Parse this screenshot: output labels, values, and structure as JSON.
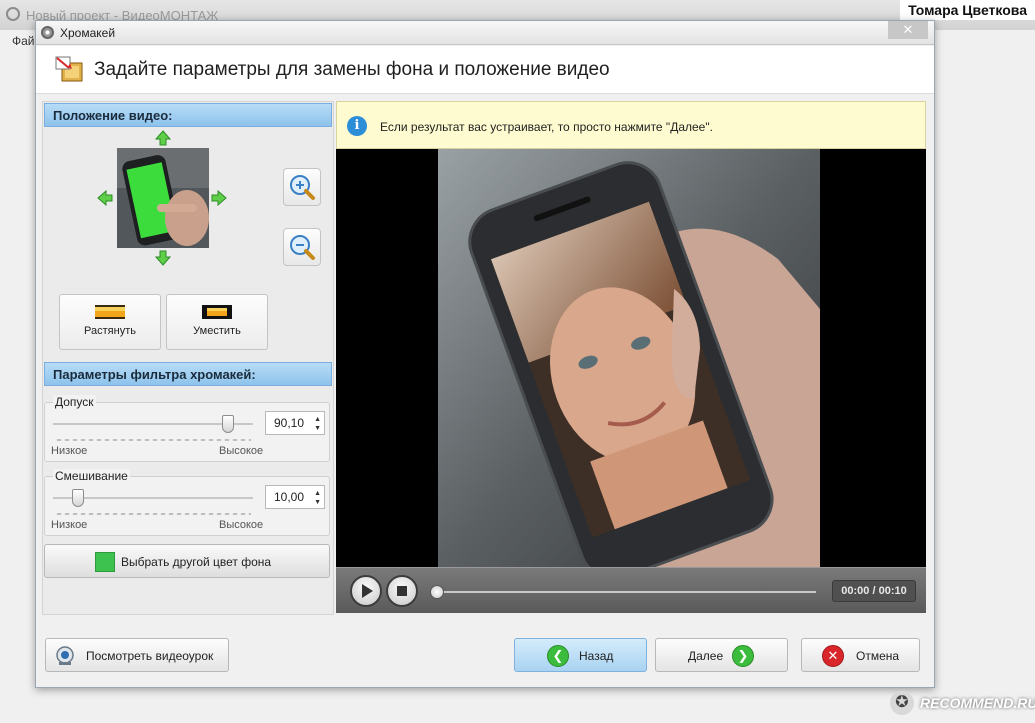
{
  "app": {
    "title": "Новый проект - ВидеоМОНТАЖ",
    "menu_file": "Фай",
    "user_overlay": "Томара Цветкова"
  },
  "dialog": {
    "title": "Хромакей",
    "close_label": "✕",
    "header": "Задайте параметры для замены фона и положение видео"
  },
  "position": {
    "heading": "Положение видео:",
    "stretch_label": "Растянуть",
    "fit_label": "Уместить"
  },
  "filter": {
    "heading": "Параметры фильтра хромакей:",
    "tolerance": {
      "label": "Допуск",
      "value": "90,10",
      "low": "Низкое",
      "high": "Высокое",
      "level": 0.9
    },
    "blend": {
      "label": "Смешивание",
      "value": "10,00",
      "low": "Низкое",
      "high": "Высокое",
      "level": 0.1
    },
    "pick_color_label": "Выбрать другой цвет фона",
    "chroma_color": "#3ec24f"
  },
  "info": {
    "icon": "i",
    "text": "Если результат вас устраивает, то просто нажмите \"Далее\"."
  },
  "player": {
    "time": "00:00 / 00:10"
  },
  "buttons": {
    "watch_tutorial": "Посмотреть видеоурок",
    "back": "Назад",
    "next": "Далее",
    "cancel": "Отмена"
  },
  "watermark": "RECOMMEND.RU",
  "colors": {
    "section_header": "#8ec3ec",
    "back_button": "#bfe0f7",
    "green_arrow": "#3cbc3c",
    "cancel_red": "#d9262a"
  }
}
